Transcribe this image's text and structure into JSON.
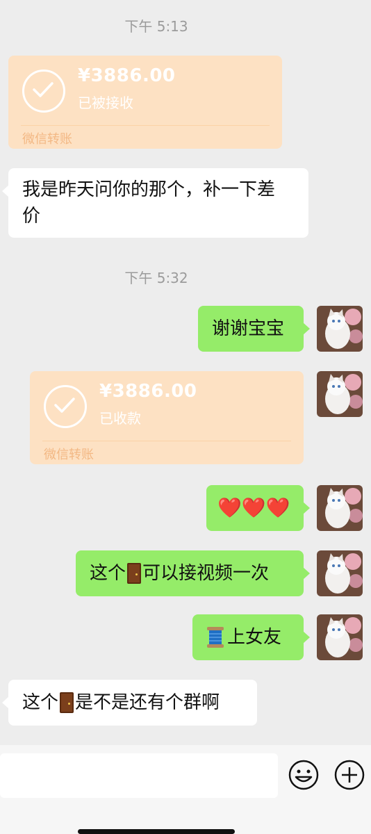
{
  "timestamps": [
    "下午 5:13",
    "下午 5:32"
  ],
  "transfers": [
    {
      "amount": "¥3886.00",
      "status": "已被接收",
      "label": "微信转账"
    },
    {
      "amount": "¥3886.00",
      "status": "已收款",
      "label": "微信转账"
    }
  ],
  "messages": {
    "m1": "我是昨天问你的那个，补一下差",
    "m1b": "价",
    "m2": "谢谢宝宝",
    "m3": "❤️❤️❤️",
    "m4a": "这个",
    "m4b": "可以接视频一次",
    "m5": "上女友",
    "m6a": "这个",
    "m6b": "是不是还有个群啊"
  },
  "icons": [
    "check-icon",
    "door-emoji-icon",
    "spool-emoji-icon",
    "emoji-face-icon",
    "plus-icon",
    "cat-avatar"
  ],
  "colors": {
    "background": "#ededed",
    "outgoing": "#95ec69",
    "incoming": "#ffffff",
    "transfer": "#fde1c3"
  }
}
